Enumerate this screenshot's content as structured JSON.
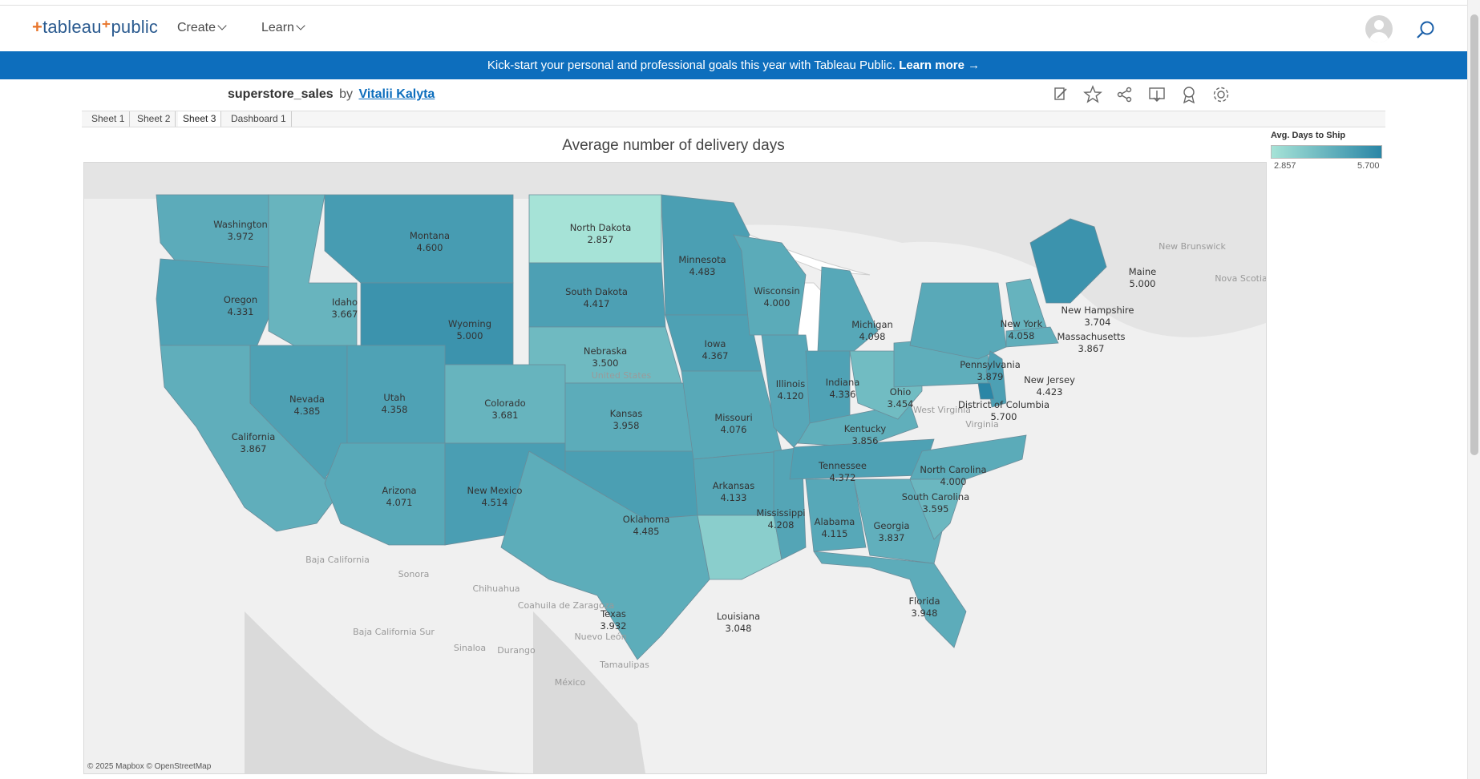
{
  "nav": {
    "logo_text": "tableau",
    "logo_suffix": "public",
    "items": [
      {
        "label": "Create"
      },
      {
        "label": "Learn"
      }
    ]
  },
  "banner": {
    "text": "Kick-start your personal and professional goals this year with Tableau Public.",
    "link": "Learn more →"
  },
  "workbook": {
    "name": "superstore_sales",
    "by": "by",
    "author": "Vitalii Kalyta"
  },
  "tabs": [
    {
      "label": "Sheet 1",
      "active": false
    },
    {
      "label": "Sheet 2",
      "active": false
    },
    {
      "label": "Sheet 3",
      "active": true
    },
    {
      "label": "Dashboard 1",
      "active": false
    }
  ],
  "toolbar_icons": [
    "edit-icon",
    "favorite-icon",
    "share-icon",
    "download-icon",
    "badge-icon",
    "settings-icon"
  ],
  "colors": {
    "accent": "#0d6ebd",
    "low": "#a6e3d7",
    "high": "#2a86a6"
  },
  "chart_data": {
    "type": "filled-map",
    "title": "Average number of delivery days",
    "measure": "Avg. Days to Ship",
    "color_range": [
      2.857,
      5.7
    ],
    "legend_min": "2.857",
    "legend_max": "5.700",
    "states": [
      {
        "name": "Washington",
        "value": "3.972"
      },
      {
        "name": "Oregon",
        "value": "4.331"
      },
      {
        "name": "California",
        "value": "3.867"
      },
      {
        "name": "Idaho",
        "value": "3.667"
      },
      {
        "name": "Nevada",
        "value": "4.385"
      },
      {
        "name": "Montana",
        "value": "4.600"
      },
      {
        "name": "Wyoming",
        "value": "5.000"
      },
      {
        "name": "Utah",
        "value": "4.358"
      },
      {
        "name": "Arizona",
        "value": "4.071"
      },
      {
        "name": "Colorado",
        "value": "3.681"
      },
      {
        "name": "New Mexico",
        "value": "4.514"
      },
      {
        "name": "North Dakota",
        "value": "2.857"
      },
      {
        "name": "South Dakota",
        "value": "4.417"
      },
      {
        "name": "Nebraska",
        "value": "3.500"
      },
      {
        "name": "Kansas",
        "value": "3.958"
      },
      {
        "name": "Oklahoma",
        "value": "4.485"
      },
      {
        "name": "Texas",
        "value": "3.932"
      },
      {
        "name": "Minnesota",
        "value": "4.483"
      },
      {
        "name": "Iowa",
        "value": "4.367"
      },
      {
        "name": "Missouri",
        "value": "4.076"
      },
      {
        "name": "Arkansas",
        "value": "4.133"
      },
      {
        "name": "Louisiana",
        "value": "3.048"
      },
      {
        "name": "Wisconsin",
        "value": "4.000"
      },
      {
        "name": "Illinois",
        "value": "4.120"
      },
      {
        "name": "Mississippi",
        "value": "4.208"
      },
      {
        "name": "Michigan",
        "value": "4.098"
      },
      {
        "name": "Indiana",
        "value": "4.336"
      },
      {
        "name": "Kentucky",
        "value": "3.856"
      },
      {
        "name": "Tennessee",
        "value": "4.372"
      },
      {
        "name": "Alabama",
        "value": "4.115"
      },
      {
        "name": "Georgia",
        "value": "3.837"
      },
      {
        "name": "Florida",
        "value": "3.948"
      },
      {
        "name": "Ohio",
        "value": "3.454"
      },
      {
        "name": "South Carolina",
        "value": "3.595"
      },
      {
        "name": "North Carolina",
        "value": "4.000"
      },
      {
        "name": "Pennsylvania",
        "value": "3.879"
      },
      {
        "name": "New York",
        "value": "4.058"
      },
      {
        "name": "New Jersey",
        "value": "4.423"
      },
      {
        "name": "District of Columbia",
        "value": "5.700"
      },
      {
        "name": "Massachusetts",
        "value": "3.867"
      },
      {
        "name": "New Hampshire",
        "value": "3.704"
      },
      {
        "name": "Maine",
        "value": "5.000"
      }
    ],
    "geo_labels": [
      "United States",
      "New Brunswick",
      "Nova Scotia",
      "Baja California",
      "Sonora",
      "Chihuahua",
      "Coahuila de Zaragoza",
      "Baja California Sur",
      "Sinaloa",
      "Durango",
      "Nuevo León",
      "Tamaulipas",
      "México",
      "West Virginia",
      "Virginia"
    ]
  },
  "map_attribution": "© 2025 Mapbox  © OpenStreetMap"
}
